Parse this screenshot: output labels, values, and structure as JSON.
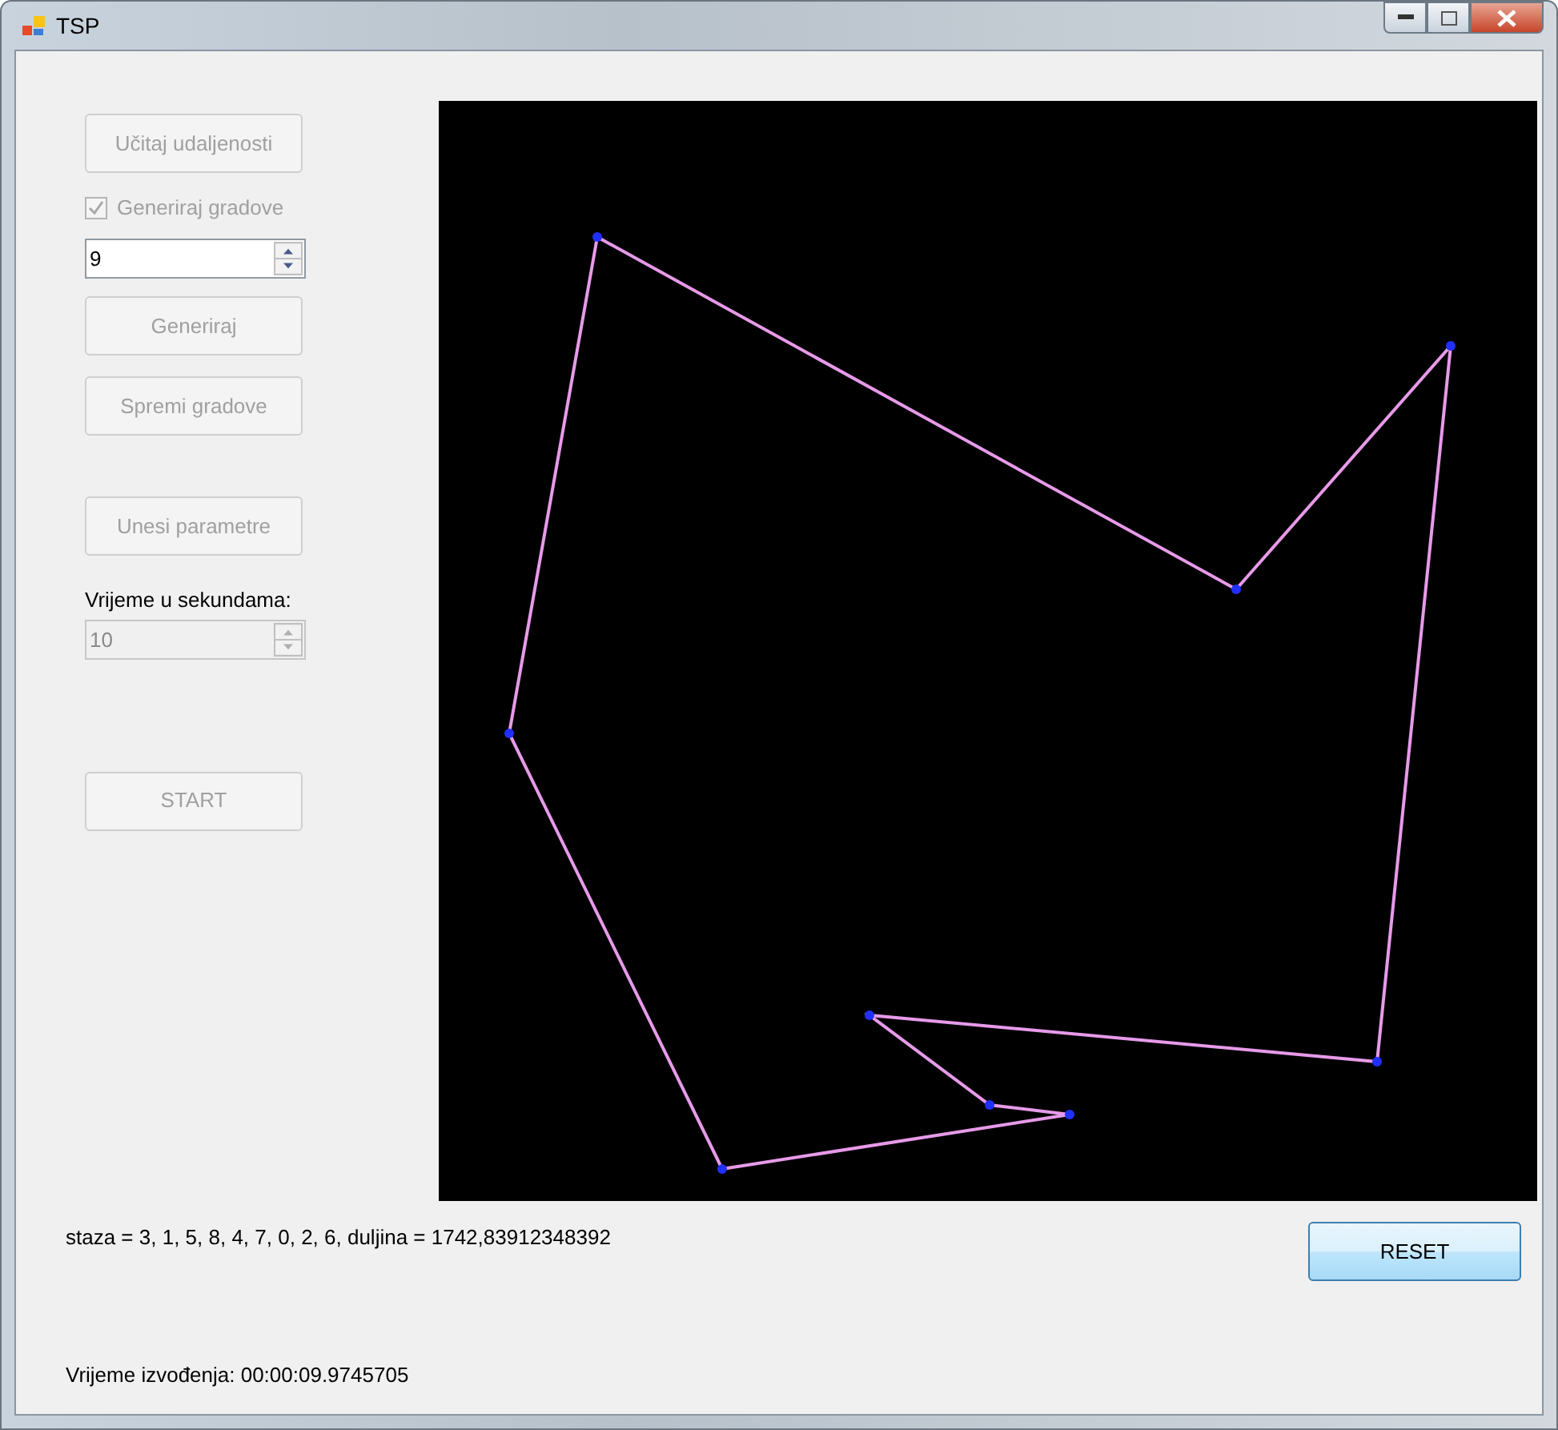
{
  "window": {
    "title": "TSP"
  },
  "load_button": {
    "label": "Učitaj udaljenosti",
    "disabled": true
  },
  "generate_checkbox": {
    "label": "Generiraj gradove",
    "checked": true,
    "disabled": true
  },
  "city_count": {
    "value": "9",
    "disabled": false
  },
  "generate_button": {
    "label": "Generiraj",
    "disabled": true
  },
  "save_button": {
    "label": "Spremi gradove",
    "disabled": true
  },
  "params_button": {
    "label": "Unesi parametre",
    "disabled": true
  },
  "time_label": "Vrijeme u sekundama:",
  "time_input": {
    "value": "10",
    "disabled": true
  },
  "start_button": {
    "label": "START",
    "disabled": true
  },
  "result": "staza = 3, 1, 5, 8, 4, 7, 0, 2, 6,  duljina = 1742,83912348392",
  "reset_button": {
    "label": "RESET",
    "disabled": false
  },
  "elapsed": "Vrijeme izvođenja: 00:00:09.9745705"
}
